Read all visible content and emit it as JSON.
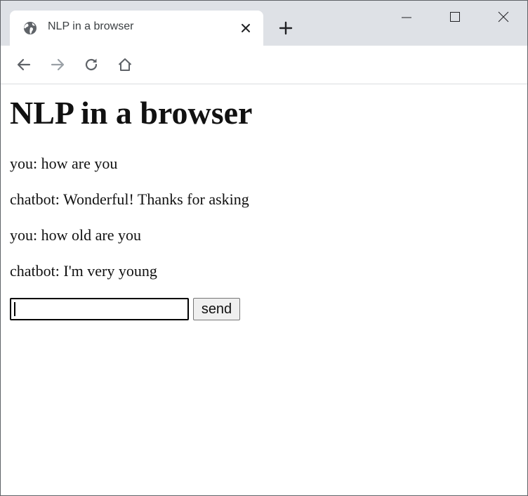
{
  "browser": {
    "tab": {
      "title": "NLP in a browser",
      "favicon": "globe-icon",
      "close_icon": "close-icon"
    },
    "new_tab_icon": "plus-icon",
    "window_controls": [
      "minimize-icon",
      "maximize-icon",
      "close-icon"
    ],
    "toolbar": [
      "back-arrow-icon",
      "forward-arrow-icon",
      "reload-icon",
      "home-icon"
    ],
    "colors": {
      "tabstrip": "#dee1e6",
      "tab": "#ffffff",
      "forward_disabled": "#9aa0a6"
    }
  },
  "page": {
    "heading": "NLP in a browser",
    "messages": [
      "you: how are you",
      "chatbot: Wonderful! Thanks for asking",
      "you: how old are you",
      "chatbot: I'm very young"
    ],
    "input": {
      "value": "",
      "placeholder": ""
    },
    "send_label": "send"
  }
}
